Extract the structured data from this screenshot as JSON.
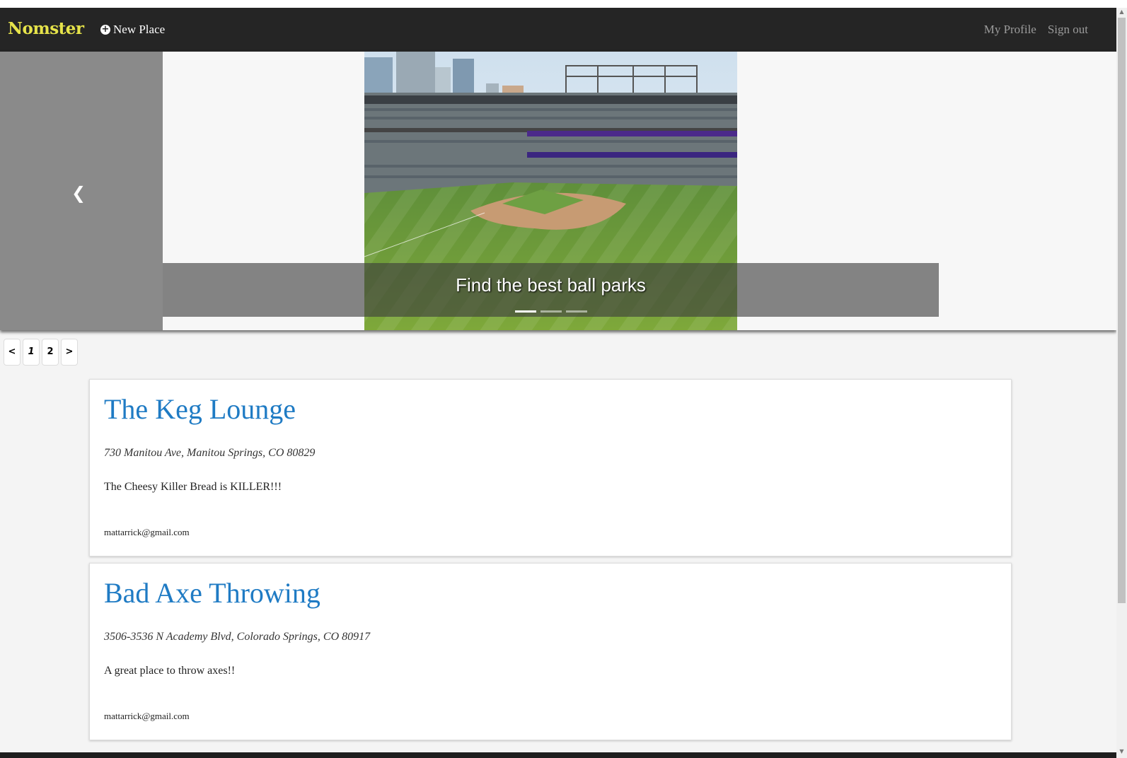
{
  "navbar": {
    "brand": "Nomster",
    "new_place_label": "New Place",
    "links": [
      "My Profile",
      "Sign out"
    ]
  },
  "carousel": {
    "caption": "Find the best ball parks",
    "indicator_count": 3,
    "active_index": 0
  },
  "pagination": {
    "prev": "<",
    "pages": [
      "1",
      "2"
    ],
    "next": ">"
  },
  "places": [
    {
      "name": "The Keg Lounge",
      "address": "730 Manitou Ave, Manitou Springs, CO 80829",
      "description": "The Cheesy Killer Bread is KILLER!!!",
      "user": "mattarrick@gmail.com"
    },
    {
      "name": "Bad Axe Throwing",
      "address": "3506-3536 N Academy Blvd, Colorado Springs, CO 80917",
      "description": "A great place to throw axes!!",
      "user": "mattarrick@gmail.com"
    }
  ]
}
